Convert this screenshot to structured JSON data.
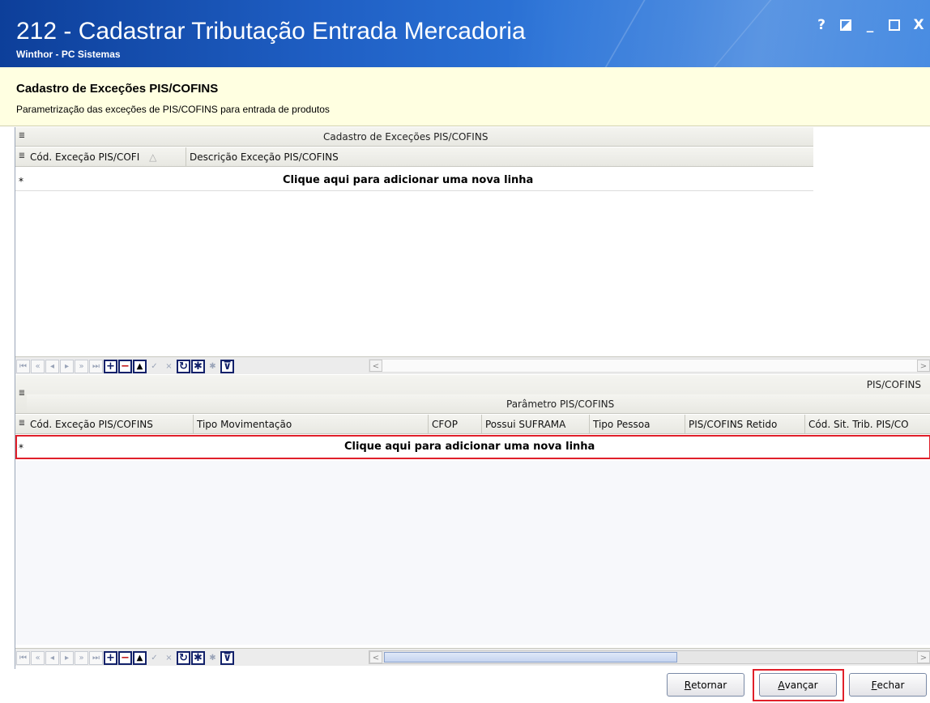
{
  "window": {
    "title": "212 - Cadastrar Tributação Entrada Mercadoria",
    "subtitle": "Winthor - PC Sistemas",
    "controls": {
      "help": "?",
      "restore_alt": "◩",
      "minimize": "_",
      "maximize": "□",
      "close": "X"
    }
  },
  "header": {
    "title": "Cadastro de Exceções PIS/COFINS",
    "description": "Parametrização das exceções de PIS/COFINS para entrada de produtos"
  },
  "grid1": {
    "caption": "Cadastro de Exceções PIS/COFINS",
    "columns": [
      "Cód. Exceção PIS/COFI",
      "Descrição Exceção PIS/COFINS"
    ],
    "sort_indicator": "△",
    "new_row_marker": "*",
    "new_row_text": "Clique aqui para adicionar uma nova linha"
  },
  "grid2": {
    "right_caption": "PIS/COFINS",
    "caption": "Parâmetro PIS/COFINS",
    "columns": [
      "Cód. Exceção PIS/COFINS",
      "Tipo Movimentação",
      "CFOP",
      "Possui SUFRAMA",
      "Tipo Pessoa",
      "PIS/COFINS Retido",
      "Cód. Sit. Trib. PIS/CO"
    ],
    "new_row_marker": "*",
    "new_row_text": "Clique aqui para adicionar uma nova linha"
  },
  "navigator": {
    "icons": [
      "first-icon",
      "prev-page-icon",
      "prev-icon",
      "next-icon",
      "next-page-icon",
      "last-icon",
      "insert-icon",
      "delete-icon",
      "edit-icon",
      "post-icon",
      "cancel-icon",
      "refresh-icon",
      "filter-icon",
      "clear-filter-icon",
      "funnel-icon"
    ],
    "glyphs": {
      "first": "⏮",
      "prev_page": "«",
      "prev": "◂",
      "next": "▸",
      "next_page": "»",
      "last": "⏭",
      "insert": "+",
      "delete": "−",
      "edit": "▲",
      "post": "✓",
      "cancel": "×",
      "refresh": "↻",
      "filter": "✱",
      "clear_filter": "✱",
      "funnel": "⊽"
    }
  },
  "buttons": {
    "retornar_prefix": "",
    "retornar_u": "R",
    "retornar_rest": "etornar",
    "avancar_u": "A",
    "avancar_rest": "vançar",
    "fechar_u": "F",
    "fechar_rest": "echar"
  },
  "colors": {
    "highlight": "#e0202a",
    "title_bg": "#1f5fc4",
    "header_bg": "#ffffe1"
  }
}
